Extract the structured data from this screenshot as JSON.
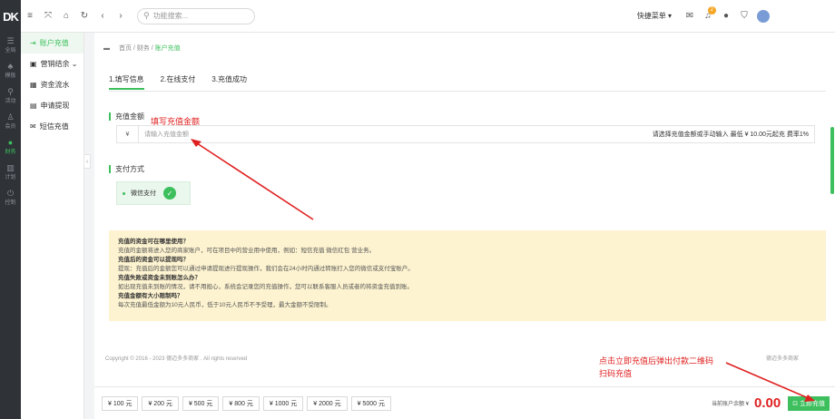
{
  "rail": {
    "logo": "DK",
    "items": [
      {
        "icon": "☰",
        "label": "全局"
      },
      {
        "icon": "♣",
        "label": "模板"
      },
      {
        "icon": "⚲",
        "label": "活动"
      },
      {
        "icon": "♙",
        "label": "会员"
      },
      {
        "icon": "●",
        "label": "财务"
      },
      {
        "icon": "▥",
        "label": "计划"
      },
      {
        "icon": "⏻",
        "label": "控制"
      }
    ]
  },
  "topbar": {
    "search_placeholder": "功能搜索...",
    "quick_entry": "快捷菜单 ▾",
    "badge": "2"
  },
  "submenu": {
    "items": [
      {
        "icon": "⇥",
        "label": "账户充值"
      },
      {
        "icon": "▣",
        "label": "营销结余 ⌄"
      },
      {
        "icon": "▦",
        "label": "资金流水"
      },
      {
        "icon": "▤",
        "label": "申请提现"
      },
      {
        "icon": "✉",
        "label": "短信充值"
      }
    ]
  },
  "breadcrumb": {
    "home": "首页",
    "finance": "财务",
    "current": "账户充值"
  },
  "steps": [
    "1.填写信息",
    "2.在线支付",
    "3.充值成功"
  ],
  "amount": {
    "title": "充值金额",
    "currency": "¥",
    "placeholder": "请输入充值金额",
    "hint": "请选择充值金额或手动输入 最低 ¥ 10.00元起充 费率1%"
  },
  "payment": {
    "title": "支付方式",
    "method": "微信支付",
    "check": "✓"
  },
  "faq": [
    {
      "q": "充值的资金可在哪里使用？",
      "a": "充值的金额将进入您的商家账户，可在项目中的营业用中使用，例如：短信充值 微信红包 营业务。"
    },
    {
      "q": "充值后的资金可以提现吗？",
      "a": "提现：充值后的金额您可以通过申请提现进行提现操作，我们会在24小时内通过转账打入您的微信或支付宝账户。"
    },
    {
      "q": "充值失败或资金未到账怎么办？",
      "a": "如出现充值未到账的情况，请不用担心，系统会记录您的充值操作，您可以联系客服人员或者的将资金充值到账。"
    },
    {
      "q": "充值金额有大小限制吗？",
      "a": "每次充值最低金额为10元人民币，低于10元人民币不予受理，最大金额不受限制。"
    }
  ],
  "footer": {
    "copyright": "Copyright © 2016 - 2023 德迈多多商家 . All rights reserved",
    "right": "德迈多多商家"
  },
  "chips": [
    "¥ 100 元",
    "¥ 200 元",
    "¥ 500 元",
    "¥ 800 元",
    "¥ 1000 元",
    "¥ 2000 元",
    "¥ 5000 元"
  ],
  "balance": {
    "label": "当前账户余额 ¥",
    "value": "0.00"
  },
  "pay_button": "⊡ 立即充值",
  "annotations": {
    "fill_amount": "填写充值金额",
    "scan_note_1": "点击立即充值后弹出付款二维码",
    "scan_note_2": "扫码充值"
  },
  "colors": {
    "accent": "#3cbf5c",
    "annotation": "#e02020",
    "faq_bg": "#fdf3d0"
  }
}
